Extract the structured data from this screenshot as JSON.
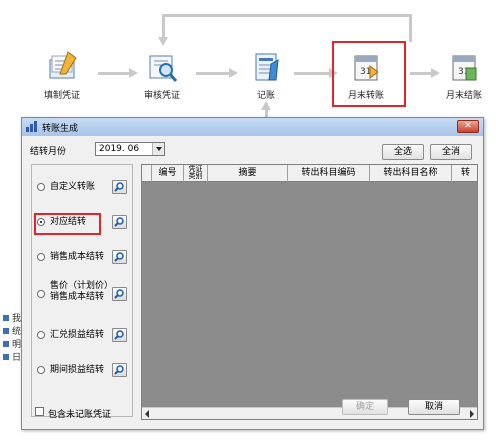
{
  "workflow": {
    "nodes": [
      {
        "label": "填制凭证",
        "icon": "voucher-entry-icon"
      },
      {
        "label": "审核凭证",
        "icon": "voucher-audit-icon"
      },
      {
        "label": "记账",
        "icon": "posting-icon"
      },
      {
        "label": "月末转账",
        "icon": "month-end-transfer-icon"
      },
      {
        "label": "月末结账",
        "icon": "month-end-close-icon"
      }
    ],
    "highlighted": "月末转账"
  },
  "dialog": {
    "title": "转账生成",
    "month_label": "结转月份",
    "month_value": "2019. 06",
    "select_all": "全选",
    "clear_all": "全消",
    "radio_options": [
      {
        "label": "自定义转账",
        "selected": false
      },
      {
        "label": "对应结转",
        "selected": true
      },
      {
        "label": "销售成本结转",
        "selected": false
      },
      {
        "label_line1": "售价（计划价）",
        "label_line2": "销售成本结转",
        "selected": false
      },
      {
        "label": "汇兑损益结转",
        "selected": false
      },
      {
        "label": "期间损益结转",
        "selected": false
      }
    ],
    "grid_columns": [
      "编号",
      "凭证类别",
      "摘要",
      "转出科目编码",
      "转出科目名称",
      "转"
    ],
    "grid_col_type_top": "凭证",
    "grid_col_type_bottom": "类别",
    "include_unposted": "包含未记账凭证",
    "confirm": "确定",
    "cancel": "取消"
  },
  "side_stubs": [
    "我",
    "统",
    "明",
    "日"
  ],
  "colors": {
    "highlight": "#e0262b",
    "grid_bg": "#8c8c8c",
    "titlebar": "#b7cff0"
  }
}
